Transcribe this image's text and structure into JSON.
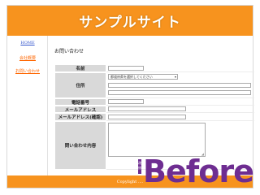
{
  "header": {
    "site_title": "サンプルサイト"
  },
  "sidebar": {
    "items": [
      {
        "label": "HOME"
      },
      {
        "label": "会社概要"
      },
      {
        "label": "お問い合わせ"
      }
    ]
  },
  "main": {
    "section_title": "お問い合わせ",
    "form": {
      "name_label": "名前",
      "address_label": "住所",
      "prefecture_select_value": "都道府県を選択してください",
      "phone_label": "電話番号",
      "email_label": "メールアドレス",
      "email_confirm_label": "メールアドレス(確認)",
      "message_label": "問い合わせ内容"
    }
  },
  "footer": {
    "copyright": "Copylight ...."
  },
  "badge": {
    "stamp_text": "改修",
    "word": "Before"
  },
  "colors": {
    "header_orange": "#f7931e",
    "badge_purple": "#6e2d91",
    "label_gray": "#d9d9d9"
  }
}
